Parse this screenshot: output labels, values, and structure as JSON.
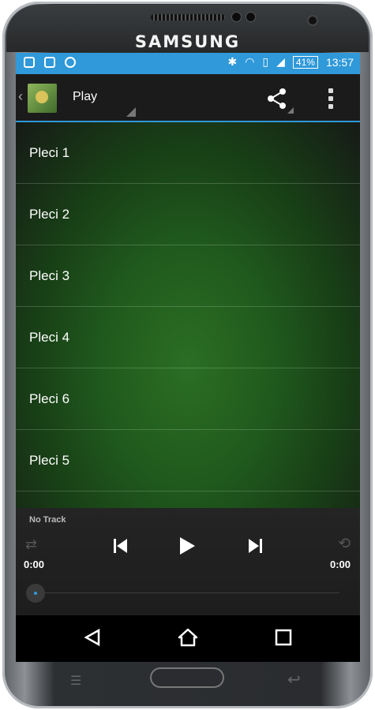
{
  "device": {
    "brand": "SAMSUNG"
  },
  "status_bar": {
    "battery": "41%",
    "time": "13:57"
  },
  "action_bar": {
    "title": "Play"
  },
  "tracks": [
    {
      "label": "Pleci 1"
    },
    {
      "label": "Pleci 2"
    },
    {
      "label": "Pleci 3"
    },
    {
      "label": "Pleci 4"
    },
    {
      "label": "Pleci 6"
    },
    {
      "label": "Pleci 5"
    },
    {
      "label": ""
    }
  ],
  "player": {
    "now_playing": "No Track",
    "elapsed": "0:00",
    "duration": "0:00",
    "progress": 0
  },
  "colors": {
    "accent": "#2f99d9",
    "background_green": "#2b6e24"
  },
  "icons": [
    "shuffle-icon",
    "previous-icon",
    "play-icon",
    "next-icon",
    "repeat-icon",
    "share-icon",
    "overflow-menu-icon",
    "nav-back-icon",
    "nav-home-icon",
    "nav-recents-icon"
  ]
}
